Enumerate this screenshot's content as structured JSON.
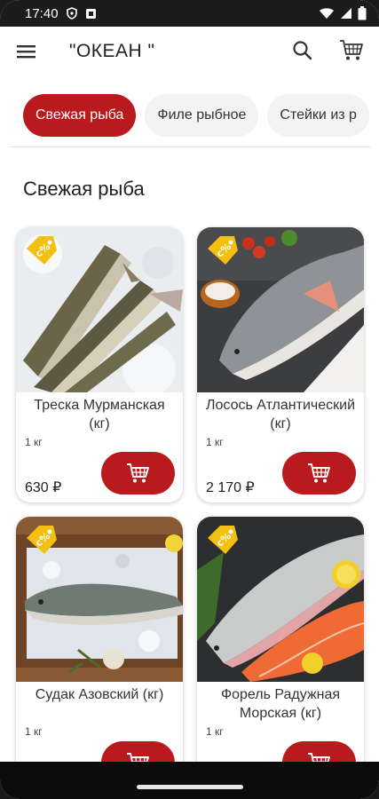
{
  "status_bar": {
    "time": "17:40"
  },
  "app_bar": {
    "title": "\"ОКЕАН \""
  },
  "categories": [
    {
      "label": "Свежая рыба",
      "active": true
    },
    {
      "label": "Филе рыбное",
      "active": false
    },
    {
      "label": "Стейки из р",
      "active": false
    }
  ],
  "section": {
    "title": "Свежая рыба"
  },
  "products": [
    {
      "name": "Треска Мурманская (кг)",
      "weight": "1 кг",
      "price": "630 ₽",
      "image_icon": "cod-fish-image"
    },
    {
      "name": "Лосось Атлантический (кг)",
      "weight": "1 кг",
      "price": "2 170 ₽",
      "image_icon": "salmon-fish-image"
    },
    {
      "name": "Судак Азовский (кг)",
      "weight": "1 кг",
      "price": "",
      "image_icon": "zander-fish-image"
    },
    {
      "name": "Форель Радужная Морская (кг)",
      "weight": "1 кг",
      "price": "",
      "image_icon": "trout-fish-image"
    }
  ],
  "colors": {
    "accent": "#b81a1e",
    "tag": "#f3c012",
    "chip_bg": "#f3f3f3"
  }
}
